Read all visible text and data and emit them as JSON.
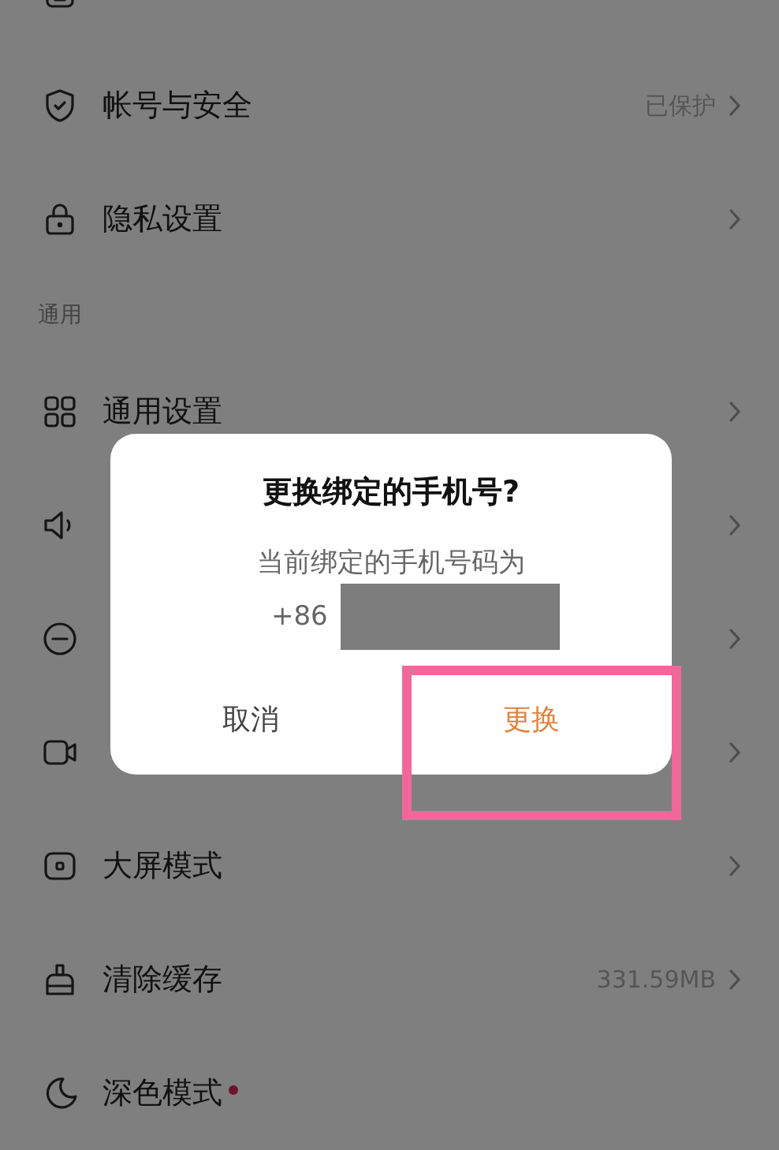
{
  "settings": {
    "items": [
      {
        "kind": "row"
      },
      {
        "kind": "row",
        "label": "帐号与安全",
        "value": "已保护",
        "chevron": true
      },
      {
        "kind": "row",
        "label": "隐私设置",
        "chevron": true
      },
      {
        "kind": "header",
        "label": "通用"
      },
      {
        "kind": "row",
        "label": "通用设置",
        "chevron": true
      },
      {
        "kind": "row",
        "chevron": true
      },
      {
        "kind": "row",
        "chevron": true
      },
      {
        "kind": "row",
        "chevron": true
      },
      {
        "kind": "row",
        "label": "大屏模式",
        "chevron": true
      },
      {
        "kind": "row",
        "label": "清除缓存",
        "value": "331.59MB",
        "chevron": true
      },
      {
        "kind": "row",
        "label": "深色模式",
        "dot": true
      }
    ]
  },
  "dialog": {
    "title": "更换绑定的手机号?",
    "message": "当前绑定的手机号码为",
    "phone_prefix": "+86",
    "phone_redacted": true,
    "buttons": [
      {
        "label": "取消",
        "primary": false,
        "annotated": false
      },
      {
        "label": "更换",
        "primary": true,
        "annotated": true
      }
    ]
  }
}
